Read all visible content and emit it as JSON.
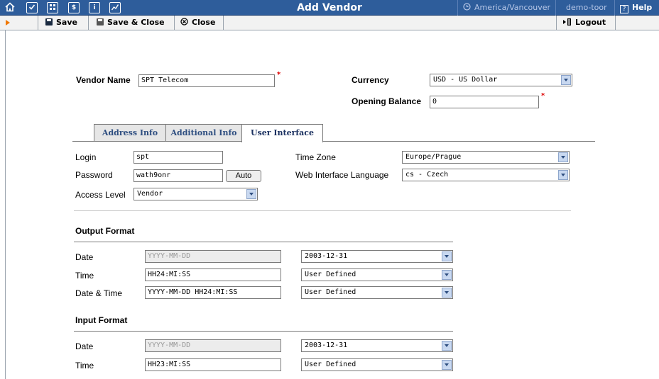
{
  "topbar": {
    "title": "Add Vendor",
    "timezone": "America/Vancouver",
    "user": "demo-toor",
    "help": "Help",
    "icons": [
      "home-icon",
      "checkbox-icon",
      "grid-icon",
      "dollar-icon",
      "info-icon",
      "chart-icon"
    ]
  },
  "toolbar": {
    "save": "Save",
    "save_close": "Save & Close",
    "close": "Close",
    "logout": "Logout"
  },
  "vendor": {
    "name_label": "Vendor Name",
    "name_value": "SPT Telecom",
    "currency_label": "Currency",
    "currency_value": "USD - US Dollar",
    "balance_label": "Opening Balance",
    "balance_value": "0",
    "required_mark": "*"
  },
  "tabs": [
    {
      "label": "Address Info"
    },
    {
      "label": "Additional Info"
    },
    {
      "label": "User Interface"
    }
  ],
  "ui": {
    "login_label": "Login",
    "login_value": "spt",
    "password_label": "Password",
    "password_value": "wath9onr",
    "auto_button": "Auto",
    "access_label": "Access Level",
    "access_value": "Vendor",
    "timezone_label": "Time Zone",
    "timezone_value": "Europe/Prague",
    "language_label": "Web Interface Language",
    "language_value": "cs - Czech"
  },
  "output_format": {
    "heading": "Output Format",
    "rows": [
      {
        "label": "Date",
        "input": "YYYY-MM-DD",
        "select": "2003-12-31"
      },
      {
        "label": "Time",
        "input": "HH24:MI:SS",
        "select": "User Defined"
      },
      {
        "label": "Date & Time",
        "input": "YYYY-MM-DD HH24:MI:SS",
        "select": "User Defined"
      }
    ]
  },
  "input_format": {
    "heading": "Input Format",
    "rows": [
      {
        "label": "Date",
        "input": "YYYY-MM-DD",
        "select": "2003-12-31"
      },
      {
        "label": "Time",
        "input": "HH23:MI:SS",
        "select": "User Defined"
      }
    ]
  }
}
